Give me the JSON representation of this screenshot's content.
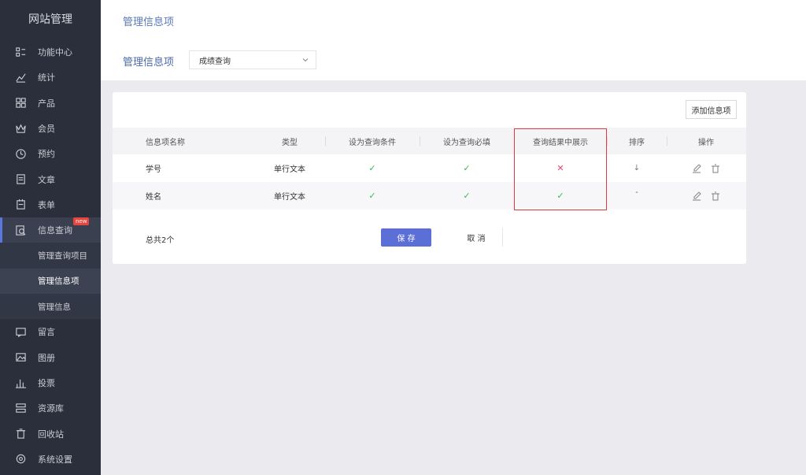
{
  "sidebar": {
    "brand": "网站管理",
    "items": [
      {
        "label": "功能中心",
        "icon": "function-icon"
      },
      {
        "label": "统计",
        "icon": "chart-line-icon"
      },
      {
        "label": "产品",
        "icon": "grid-icon"
      },
      {
        "label": "会员",
        "icon": "crown-icon"
      },
      {
        "label": "预约",
        "icon": "clock-icon"
      },
      {
        "label": "文章",
        "icon": "document-icon"
      },
      {
        "label": "表单",
        "icon": "form-icon"
      },
      {
        "label": "信息查询",
        "icon": "search-doc-icon",
        "badge": "new"
      },
      {
        "label": "留言",
        "icon": "message-icon"
      },
      {
        "label": "图册",
        "icon": "image-icon"
      },
      {
        "label": "投票",
        "icon": "bar-chart-icon"
      },
      {
        "label": "资源库",
        "icon": "library-icon"
      },
      {
        "label": "回收站",
        "icon": "trash-icon"
      },
      {
        "label": "系统设置",
        "icon": "settings-icon"
      }
    ],
    "sub_items": [
      {
        "label": "管理查询项目"
      },
      {
        "label": "管理信息项"
      },
      {
        "label": "管理信息"
      }
    ]
  },
  "header": {
    "title": "管理信息项",
    "filter_label": "管理信息项",
    "select_value": "成绩查询"
  },
  "card": {
    "add_button": "添加信息项",
    "columns": [
      "信息项名称",
      "类型",
      "设为查询条件",
      "设为查询必填",
      "查询结果中展示",
      "排序",
      "操作"
    ],
    "rows": [
      {
        "name": "学号",
        "type": "单行文本",
        "cond": "check",
        "req": "check",
        "show": "cross",
        "sort": "↓"
      },
      {
        "name": "姓名",
        "type": "单行文本",
        "cond": "check",
        "req": "check",
        "show": "check",
        "sort": "ˆ"
      }
    ],
    "total": "总共2个",
    "save": "保 存",
    "cancel": "取 消"
  },
  "colors": {
    "sidebar_bg": "#2a2f3b",
    "accent": "#5b6fd6",
    "check": "#3db857",
    "cross": "#e4466a",
    "highlight": "#e0393e",
    "badge": "#e8453c"
  }
}
